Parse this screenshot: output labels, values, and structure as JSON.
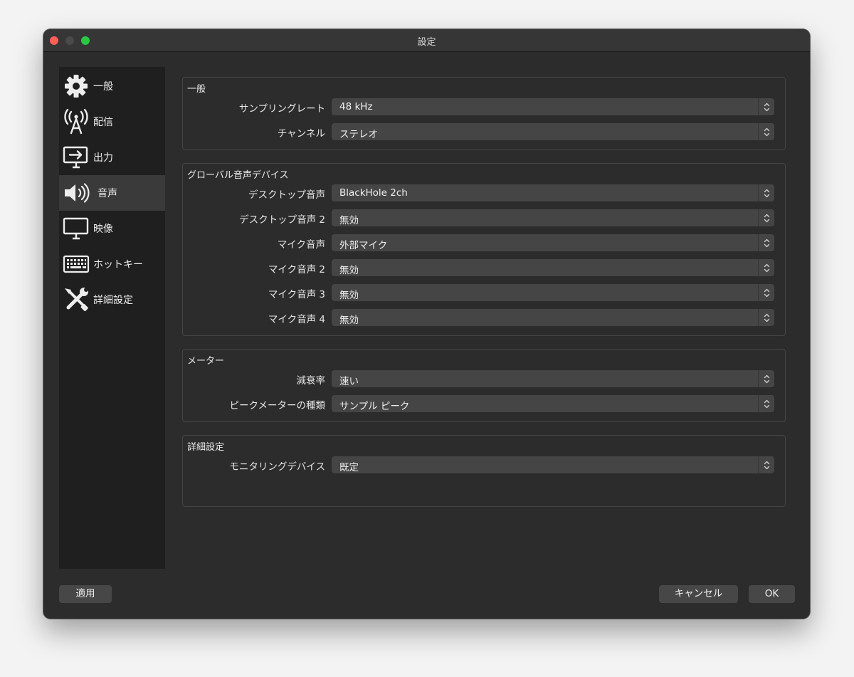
{
  "window": {
    "title": "設定"
  },
  "sidebar": {
    "items": [
      {
        "label": "一般",
        "icon": "gear-icon"
      },
      {
        "label": "配信",
        "icon": "broadcast-antenna-icon"
      },
      {
        "label": "出力",
        "icon": "output-monitor-icon"
      },
      {
        "label": "音声",
        "icon": "speaker-icon",
        "selected": true
      },
      {
        "label": "映像",
        "icon": "monitor-icon"
      },
      {
        "label": "ホットキー",
        "icon": "keyboard-icon"
      },
      {
        "label": "詳細設定",
        "icon": "tools-icon"
      }
    ]
  },
  "groups": {
    "general": {
      "title": "一般",
      "rows": [
        {
          "label": "サンプリングレート",
          "value": "48 kHz"
        },
        {
          "label": "チャンネル",
          "value": "ステレオ"
        }
      ]
    },
    "global_audio": {
      "title": "グローバル音声デバイス",
      "rows": [
        {
          "label": "デスクトップ音声",
          "value": "BlackHole 2ch"
        },
        {
          "label": "デスクトップ音声 2",
          "value": "無効"
        },
        {
          "label": "マイク音声",
          "value": "外部マイク"
        },
        {
          "label": "マイク音声 2",
          "value": "無効"
        },
        {
          "label": "マイク音声 3",
          "value": "無効"
        },
        {
          "label": "マイク音声 4",
          "value": "無効"
        }
      ]
    },
    "meters": {
      "title": "メーター",
      "rows": [
        {
          "label": "減衰率",
          "value": "速い"
        },
        {
          "label": "ピークメーターの種類",
          "value": "サンプル ピーク"
        }
      ]
    },
    "advanced": {
      "title": "詳細設定",
      "rows": [
        {
          "label": "モニタリングデバイス",
          "value": "既定"
        }
      ]
    }
  },
  "buttons": {
    "apply": "適用",
    "cancel": "キャンセル",
    "ok": "OK"
  },
  "colors": {
    "close": "#fe5f57",
    "minimize_inactive": "#4a4a4a",
    "maximize": "#28c840",
    "selected_bg": "#3a3a3a"
  }
}
